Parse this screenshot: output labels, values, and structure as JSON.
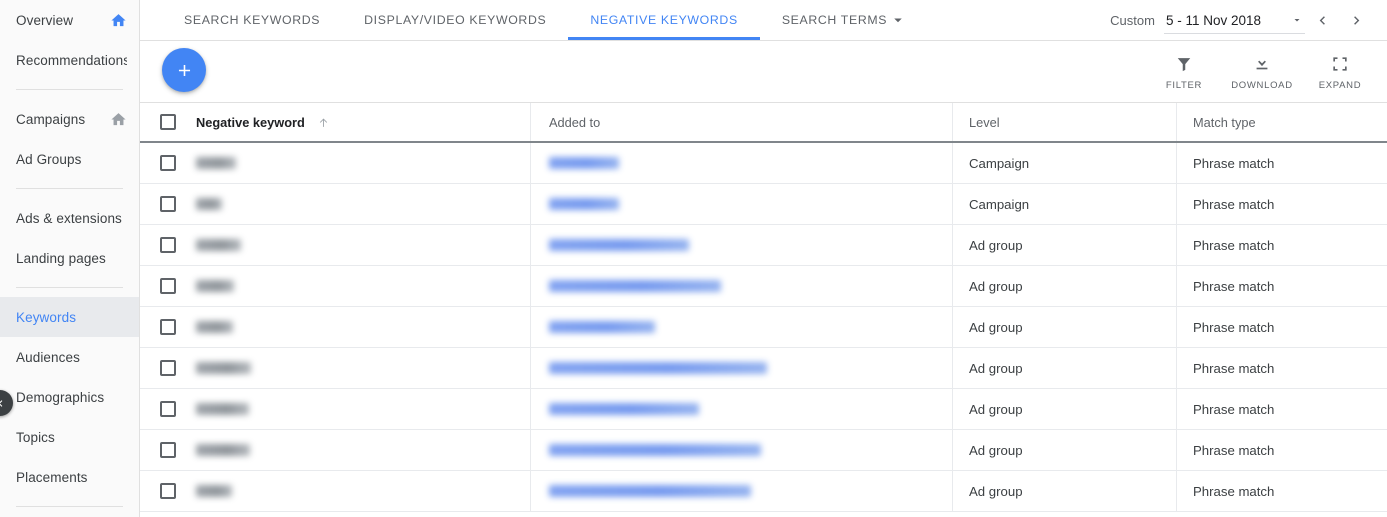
{
  "sidebar": {
    "groups": [
      {
        "items": [
          {
            "label": "Overview",
            "icon": "home-icon",
            "icon_color": "#4285f4",
            "active": false
          },
          {
            "label": "Recommendations",
            "icon": null,
            "active": false
          }
        ]
      },
      {
        "items": [
          {
            "label": "Campaigns",
            "icon": "home-icon",
            "icon_color": "#9aa0a6",
            "active": false
          },
          {
            "label": "Ad Groups",
            "icon": null,
            "active": false
          }
        ]
      },
      {
        "items": [
          {
            "label": "Ads & extensions",
            "icon": null,
            "active": false
          },
          {
            "label": "Landing pages",
            "icon": null,
            "active": false
          }
        ]
      },
      {
        "items": [
          {
            "label": "Keywords",
            "icon": null,
            "active": true
          },
          {
            "label": "Audiences",
            "icon": null,
            "active": false
          },
          {
            "label": "Demographics",
            "icon": null,
            "active": false
          },
          {
            "label": "Topics",
            "icon": null,
            "active": false
          },
          {
            "label": "Placements",
            "icon": null,
            "active": false
          }
        ]
      }
    ],
    "collapse_button": {
      "icon": "chevron-left-icon"
    }
  },
  "tabs": [
    {
      "label": "SEARCH KEYWORDS",
      "active": false,
      "caret": false
    },
    {
      "label": "DISPLAY/VIDEO KEYWORDS",
      "active": false,
      "caret": false
    },
    {
      "label": "NEGATIVE KEYWORDS",
      "active": true,
      "caret": false
    },
    {
      "label": "SEARCH TERMS",
      "active": false,
      "caret": true
    }
  ],
  "date_range": {
    "label": "Custom",
    "value": "5 - 11 Nov 2018",
    "caret_icon": "chevron-down-icon",
    "prev_icon": "chevron-left-icon",
    "next_icon": "chevron-right-icon"
  },
  "toolbar": {
    "add_button": {
      "icon": "plus-icon",
      "color": "#4285f4"
    },
    "tools": [
      {
        "label": "FILTER",
        "icon": "filter-funnel-icon"
      },
      {
        "label": "DOWNLOAD",
        "icon": "download-icon"
      },
      {
        "label": "EXPAND",
        "icon": "expand-icon"
      }
    ]
  },
  "table": {
    "columns": [
      {
        "key": "keyword",
        "label": "Negative keyword",
        "sorted": true,
        "sort_dir": "asc"
      },
      {
        "key": "added_to",
        "label": "Added to",
        "sorted": false
      },
      {
        "key": "level",
        "label": "Level",
        "sorted": false
      },
      {
        "key": "match_type",
        "label": "Match type",
        "sorted": false
      }
    ],
    "select_all_checked": false,
    "rows": [
      {
        "checked": false,
        "keyword_redacted": true,
        "keyword_width": 40,
        "added_to_redacted": true,
        "added_to_width": 70,
        "level": "Campaign",
        "match_type": "Phrase match"
      },
      {
        "checked": false,
        "keyword_redacted": true,
        "keyword_width": 26,
        "added_to_redacted": true,
        "added_to_width": 70,
        "level": "Campaign",
        "match_type": "Phrase match"
      },
      {
        "checked": false,
        "keyword_redacted": true,
        "keyword_width": 45,
        "added_to_redacted": true,
        "added_to_width": 140,
        "level": "Ad group",
        "match_type": "Phrase match"
      },
      {
        "checked": false,
        "keyword_redacted": true,
        "keyword_width": 38,
        "added_to_redacted": true,
        "added_to_width": 172,
        "level": "Ad group",
        "match_type": "Phrase match"
      },
      {
        "checked": false,
        "keyword_redacted": true,
        "keyword_width": 37,
        "added_to_redacted": true,
        "added_to_width": 106,
        "level": "Ad group",
        "match_type": "Phrase match"
      },
      {
        "checked": false,
        "keyword_redacted": true,
        "keyword_width": 55,
        "added_to_redacted": true,
        "added_to_width": 218,
        "level": "Ad group",
        "match_type": "Phrase match"
      },
      {
        "checked": false,
        "keyword_redacted": true,
        "keyword_width": 53,
        "added_to_redacted": true,
        "added_to_width": 150,
        "level": "Ad group",
        "match_type": "Phrase match"
      },
      {
        "checked": false,
        "keyword_redacted": true,
        "keyword_width": 54,
        "added_to_redacted": true,
        "added_to_width": 212,
        "level": "Ad group",
        "match_type": "Phrase match"
      },
      {
        "checked": false,
        "keyword_redacted": true,
        "keyword_width": 36,
        "added_to_redacted": true,
        "added_to_width": 202,
        "level": "Ad group",
        "match_type": "Phrase match"
      }
    ]
  },
  "colors": {
    "accent": "#4285f4",
    "text_primary": "#202124",
    "text_secondary": "#5f6368",
    "sidebar_bg": "#fafafa",
    "sidebar_active_bg": "#e8eaed",
    "border": "#e0e0e0"
  }
}
